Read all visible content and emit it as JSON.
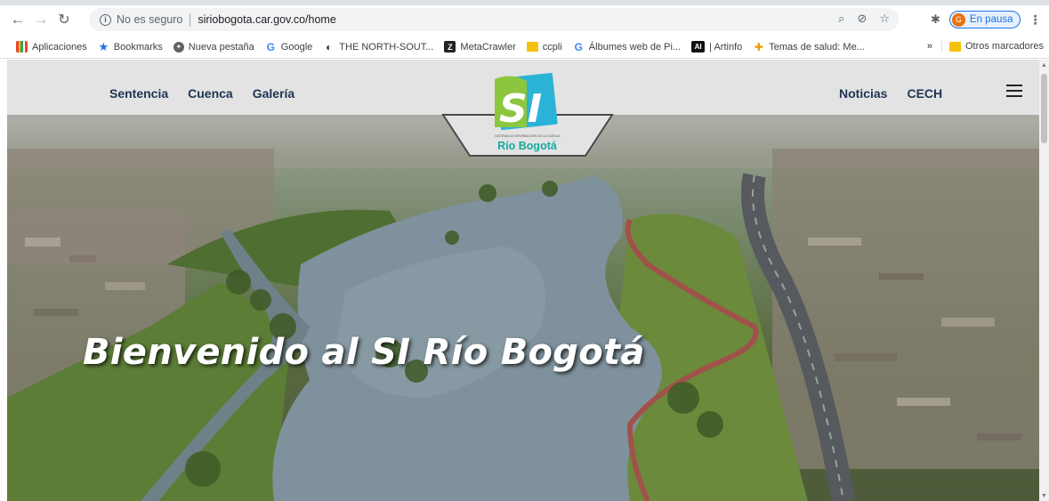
{
  "browser": {
    "security_text": "No es seguro",
    "url": "siriobogota.car.gov.co/home",
    "profile_status": "En pausa",
    "profile_initial": "G"
  },
  "bookmarks": {
    "items": [
      {
        "label": "Aplicaciones",
        "icon": "apps-icon"
      },
      {
        "label": "Bookmarks",
        "icon": "star-icon"
      },
      {
        "label": "Nueva pestaña",
        "icon": "globe-icon"
      },
      {
        "label": "Google",
        "icon": "google-icon"
      },
      {
        "label": "THE NORTH-SOUT...",
        "icon": "north-south-icon"
      },
      {
        "label": "MetaCrawler",
        "icon": "metacrawler-icon"
      },
      {
        "label": "ccpli",
        "icon": "folder-icon"
      },
      {
        "label": "Álbumes web de Pi...",
        "icon": "google-icon"
      },
      {
        "label": "| Artinfo",
        "icon": "artinfo-icon"
      },
      {
        "label": "Temas de salud: Me...",
        "icon": "health-icon"
      }
    ],
    "overflow": "»",
    "other_label": "Otros marcadores"
  },
  "site": {
    "nav_left": [
      "Sentencia",
      "Cuenca",
      "Galería"
    ],
    "nav_right": [
      "Noticias",
      "CECH"
    ],
    "logo_mark": "SI",
    "logo_small_text": "SISTEMA DE INFORMACIÓN DE LA CUENCA",
    "logo_name": "Río Bogotá",
    "hero_title": "Bienvenido al SI Río Bogotá"
  },
  "colors": {
    "nav_text": "#1f3352",
    "logo_teal": "#18a9a0",
    "logo_green": "#8cc63f",
    "logo_blue": "#2ab3d6"
  }
}
